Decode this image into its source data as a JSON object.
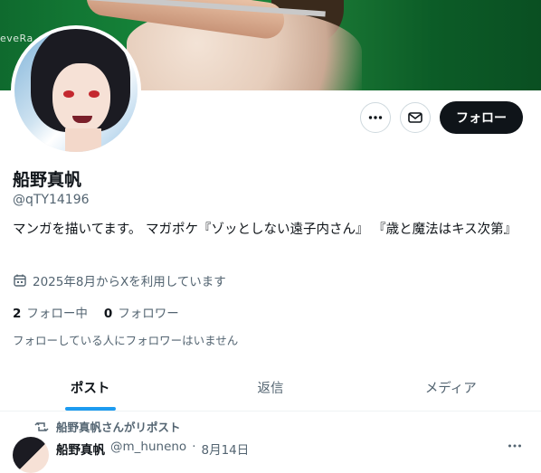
{
  "banner": {
    "watermark": "eveRa"
  },
  "profile": {
    "name": "船野真帆",
    "handle": "@qTY14196",
    "bio": "マンガを描いてます。 マガポケ『ゾッとしない遠子内さん』 『歳と魔法はキス次第』",
    "joined": "2025年8月からXを利用しています",
    "following_count": "2",
    "following_label": "フォロー中",
    "followers_count": "0",
    "followers_label": "フォロワー",
    "mutual_notice": "フォローしている人にフォロワーはいません"
  },
  "actions": {
    "follow_label": "フォロー",
    "more_icon": "more-icon",
    "message_icon": "mail-icon"
  },
  "tabs": [
    {
      "label": "ポスト",
      "active": true
    },
    {
      "label": "返信",
      "active": false
    },
    {
      "label": "メディア",
      "active": false
    }
  ],
  "post": {
    "repost_label": "船野真帆さんがリポスト",
    "author_name": "船野真帆",
    "author_handle": "@m_huneno",
    "separator": "·",
    "date": "8月14日"
  },
  "colors": {
    "accent": "#1d9bf0",
    "text": "#0f1419",
    "muted": "#536471",
    "banner": "#178a3c"
  }
}
